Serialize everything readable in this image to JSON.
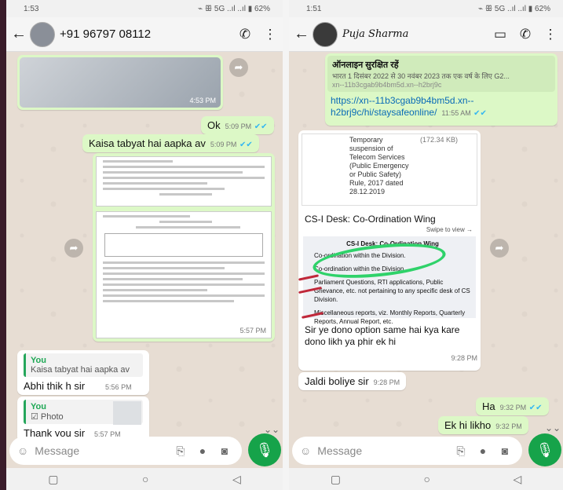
{
  "left": {
    "status": {
      "time": "1:53",
      "right": "⌁ ꕥ 5G ..ıl ..ıl ▮ 62%"
    },
    "header": {
      "contact": "+91 96797 08112"
    },
    "messages": {
      "image_time": "4:53 PM",
      "m1_text": "Ok",
      "m1_time": "5:09 PM",
      "m2_text": "Kaisa tabyat hai aapka av",
      "m2_time": "5:09 PM",
      "doc_time": "5:57 PM",
      "m3_quote_name": "You",
      "m3_quote_text": "Kaisa tabyat hai aapka av",
      "m3_text": "Abhi thik h sir",
      "m3_time": "5:56 PM",
      "m4_quote_name": "You",
      "m4_quote_text": "☑ Photo",
      "m4_text": "Thank you sir",
      "m4_time": "5:57 PM"
    },
    "composer": {
      "placeholder": "Message"
    }
  },
  "right": {
    "status": {
      "time": "1:51",
      "right": "⌁ ꕥ 5G ..ıl ..ıl ▮ 62%"
    },
    "header": {
      "contact": "Puja Sharma"
    },
    "messages": {
      "preview_title": "ऑनलाइन सुरक्षित रहें",
      "preview_desc": "भारत 1 दिसंबर 2022 से 30 नवंबर 2023 तक एक वर्ष के लिए G2...",
      "preview_domain": "xn--11b3cgab9b4bm5d.xn--h2brj9c",
      "link_text": "https://xn--11b3cgab9b4bm5d.xn--h2brj9c/hi/staysafeonline/",
      "link_time": "11:55 AM",
      "doc_table_text": "Temporary suspension of Telecom Services (Public Emergency or Public Safety) Rule, 2017 dated 28.12.2019",
      "doc_size": "(172.34 KB)",
      "doc_heading": "CS-I Desk: Co-Ordination Wing",
      "swipe": "Swipe to view →",
      "doc_inner_title": "CS-I Desk: Co-Ordination Wing",
      "doc_b1": "Co-ordination within the Division.",
      "doc_b2": "Co-ordination within the Division.",
      "doc_b3": "Parliament Questions, RTI applications, Public Grievance, etc. not pertaining to any specific desk of CS Division.",
      "doc_b4": "Miscellaneous reports, viz. Monthly Reports, Quarterly Reports, Annual Report, etc.",
      "question": "Sir ye dono option same hai kya kare dono likh ya phir ek hi",
      "question_time": "9:28 PM",
      "r1_text": "Jaldi boliye sir",
      "r1_time": "9:28 PM",
      "o1_text": "Ha",
      "o1_time": "9:32 PM",
      "o2_text": "Ek hi likho",
      "o2_time": "9:32 PM"
    },
    "composer": {
      "placeholder": "Message"
    }
  },
  "colors": {
    "accent": "#16a34a",
    "outgoing": "#dcf8c6",
    "tick": "#34b7f1"
  }
}
